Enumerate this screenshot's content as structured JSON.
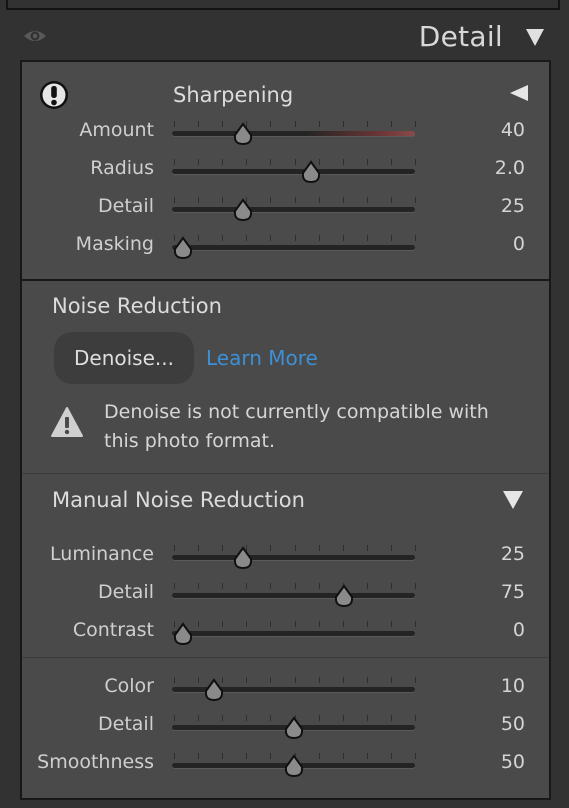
{
  "header": {
    "title": "Detail",
    "visibility_icon": "eye-icon",
    "collapse_icon": "triangle-down-icon"
  },
  "sharpening": {
    "title": "Sharpening",
    "warning_icon": "exclamation-circle-icon",
    "collapse_icon": "triangle-left-icon",
    "rows": [
      {
        "label": "Amount",
        "value": "40",
        "fraction": 0.27
      },
      {
        "label": "Radius",
        "value": "2.0",
        "fraction": 0.58
      },
      {
        "label": "Detail",
        "value": "25",
        "fraction": 0.27
      },
      {
        "label": "Masking",
        "value": "0",
        "fraction": 0.0
      }
    ]
  },
  "noise_reduction": {
    "title": "Noise Reduction",
    "denoise_button": "Denoise...",
    "learn_more": "Learn More",
    "warning_icon": "warning-triangle-icon",
    "warning_text": "Denoise is not currently compatible with this photo format."
  },
  "manual_noise_reduction": {
    "title": "Manual Noise Reduction",
    "collapse_icon": "triangle-down-icon",
    "luminance_rows": [
      {
        "label": "Luminance",
        "value": "25",
        "fraction": 0.27
      },
      {
        "label": "Detail",
        "value": "75",
        "fraction": 0.73
      },
      {
        "label": "Contrast",
        "value": "0",
        "fraction": 0.0
      }
    ],
    "color_rows": [
      {
        "label": "Color",
        "value": "10",
        "fraction": 0.14
      },
      {
        "label": "Detail",
        "value": "50",
        "fraction": 0.5
      },
      {
        "label": "Smoothness",
        "value": "50",
        "fraction": 0.5
      }
    ]
  },
  "colors": {
    "link": "#3d8fd6",
    "panel": "#4a4a4a",
    "background": "#323232"
  }
}
